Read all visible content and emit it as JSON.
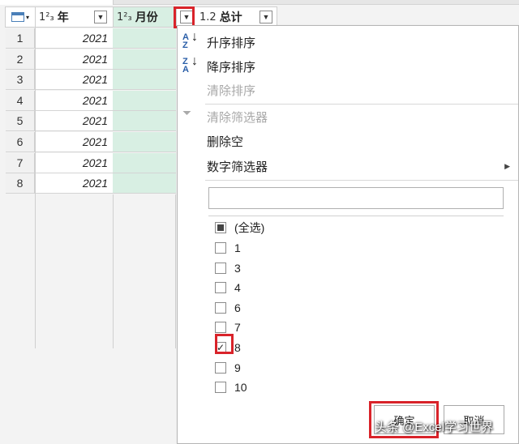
{
  "columns": [
    {
      "type_icon": "1²₃",
      "label": "年"
    },
    {
      "type_icon": "1²₃",
      "label": "月份"
    },
    {
      "type_icon": "1.2",
      "label": "总计"
    }
  ],
  "rows": [
    {
      "num": "1",
      "year": "2021"
    },
    {
      "num": "2",
      "year": "2021"
    },
    {
      "num": "3",
      "year": "2021"
    },
    {
      "num": "4",
      "year": "2021"
    },
    {
      "num": "5",
      "year": "2021"
    },
    {
      "num": "6",
      "year": "2021"
    },
    {
      "num": "7",
      "year": "2021"
    },
    {
      "num": "8",
      "year": "2021"
    }
  ],
  "menu": {
    "sort_asc": "升序排序",
    "sort_desc": "降序排序",
    "clear_sort": "清除排序",
    "clear_filter": "清除筛选器",
    "remove_empty": "删除空",
    "number_filters": "数字筛选器",
    "search_value": "",
    "select_all": "(全选)",
    "values": [
      "1",
      "3",
      "4",
      "6",
      "7",
      "8",
      "9",
      "10"
    ],
    "checked_value": "8",
    "ok": "确定",
    "cancel": "取消"
  },
  "watermark": "头条 @Excel学习世界",
  "colors": {
    "highlight": "#d9232a",
    "month_column": "#d8efe3"
  }
}
